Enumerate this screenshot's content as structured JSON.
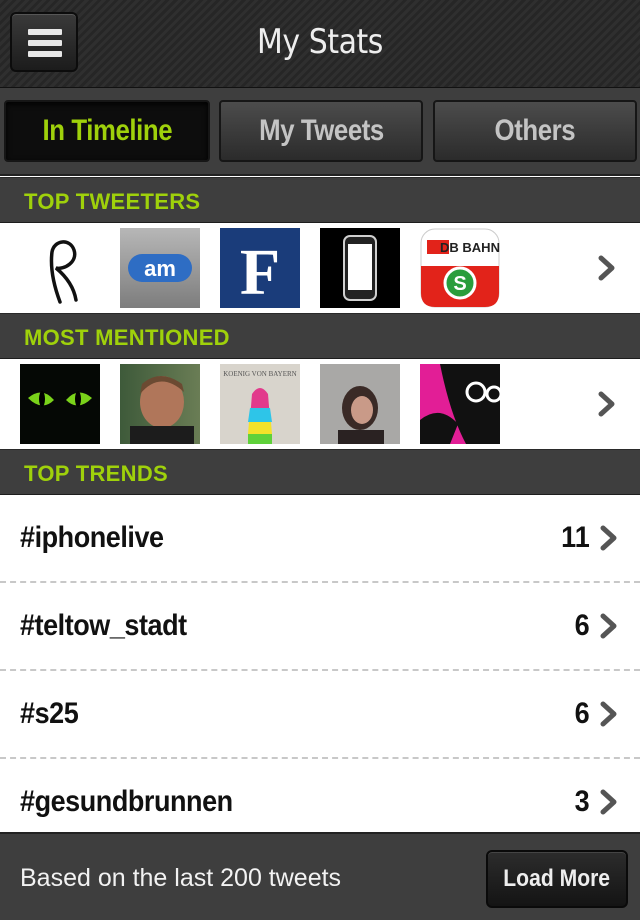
{
  "header": {
    "title": "My Stats",
    "menu_icon": "hamburger-menu-icon"
  },
  "tabs": [
    {
      "label": "In Timeline",
      "active": true
    },
    {
      "label": "My Tweets",
      "active": false
    },
    {
      "label": "Others",
      "active": false
    }
  ],
  "sections": {
    "top_tweeters": "TOP TWEETERS",
    "most_mentioned": "MOST MENTIONED",
    "top_trends": "TOP TRENDS"
  },
  "top_tweeters": [
    {
      "icon": "script-r-logo"
    },
    {
      "icon": "am-logo",
      "text": "am"
    },
    {
      "icon": "f-logo",
      "text": "F"
    },
    {
      "icon": "phone-logo"
    },
    {
      "icon": "db-bahn-s-logo",
      "text": "DB BAHN"
    }
  ],
  "most_mentioned": [
    {
      "icon": "cat-eyes-avatar"
    },
    {
      "icon": "man-portrait-avatar"
    },
    {
      "icon": "rainbow-figure-avatar",
      "text": "KOENIG VON BAYERN"
    },
    {
      "icon": "woman-portrait-avatar"
    },
    {
      "icon": "pink-glasses-avatar"
    }
  ],
  "trends": [
    {
      "tag": "#iphonelive",
      "count": "11"
    },
    {
      "tag": "#teltow_stadt",
      "count": "6"
    },
    {
      "tag": "#s25",
      "count": "6"
    },
    {
      "tag": "#gesundbrunnen",
      "count": "3"
    }
  ],
  "footer": {
    "text": "Based on the last 200 tweets",
    "button": "Load More"
  },
  "colors": {
    "accent": "#9fd10b",
    "bar": "#3e3e3e",
    "dark": "#0d0d0d"
  }
}
